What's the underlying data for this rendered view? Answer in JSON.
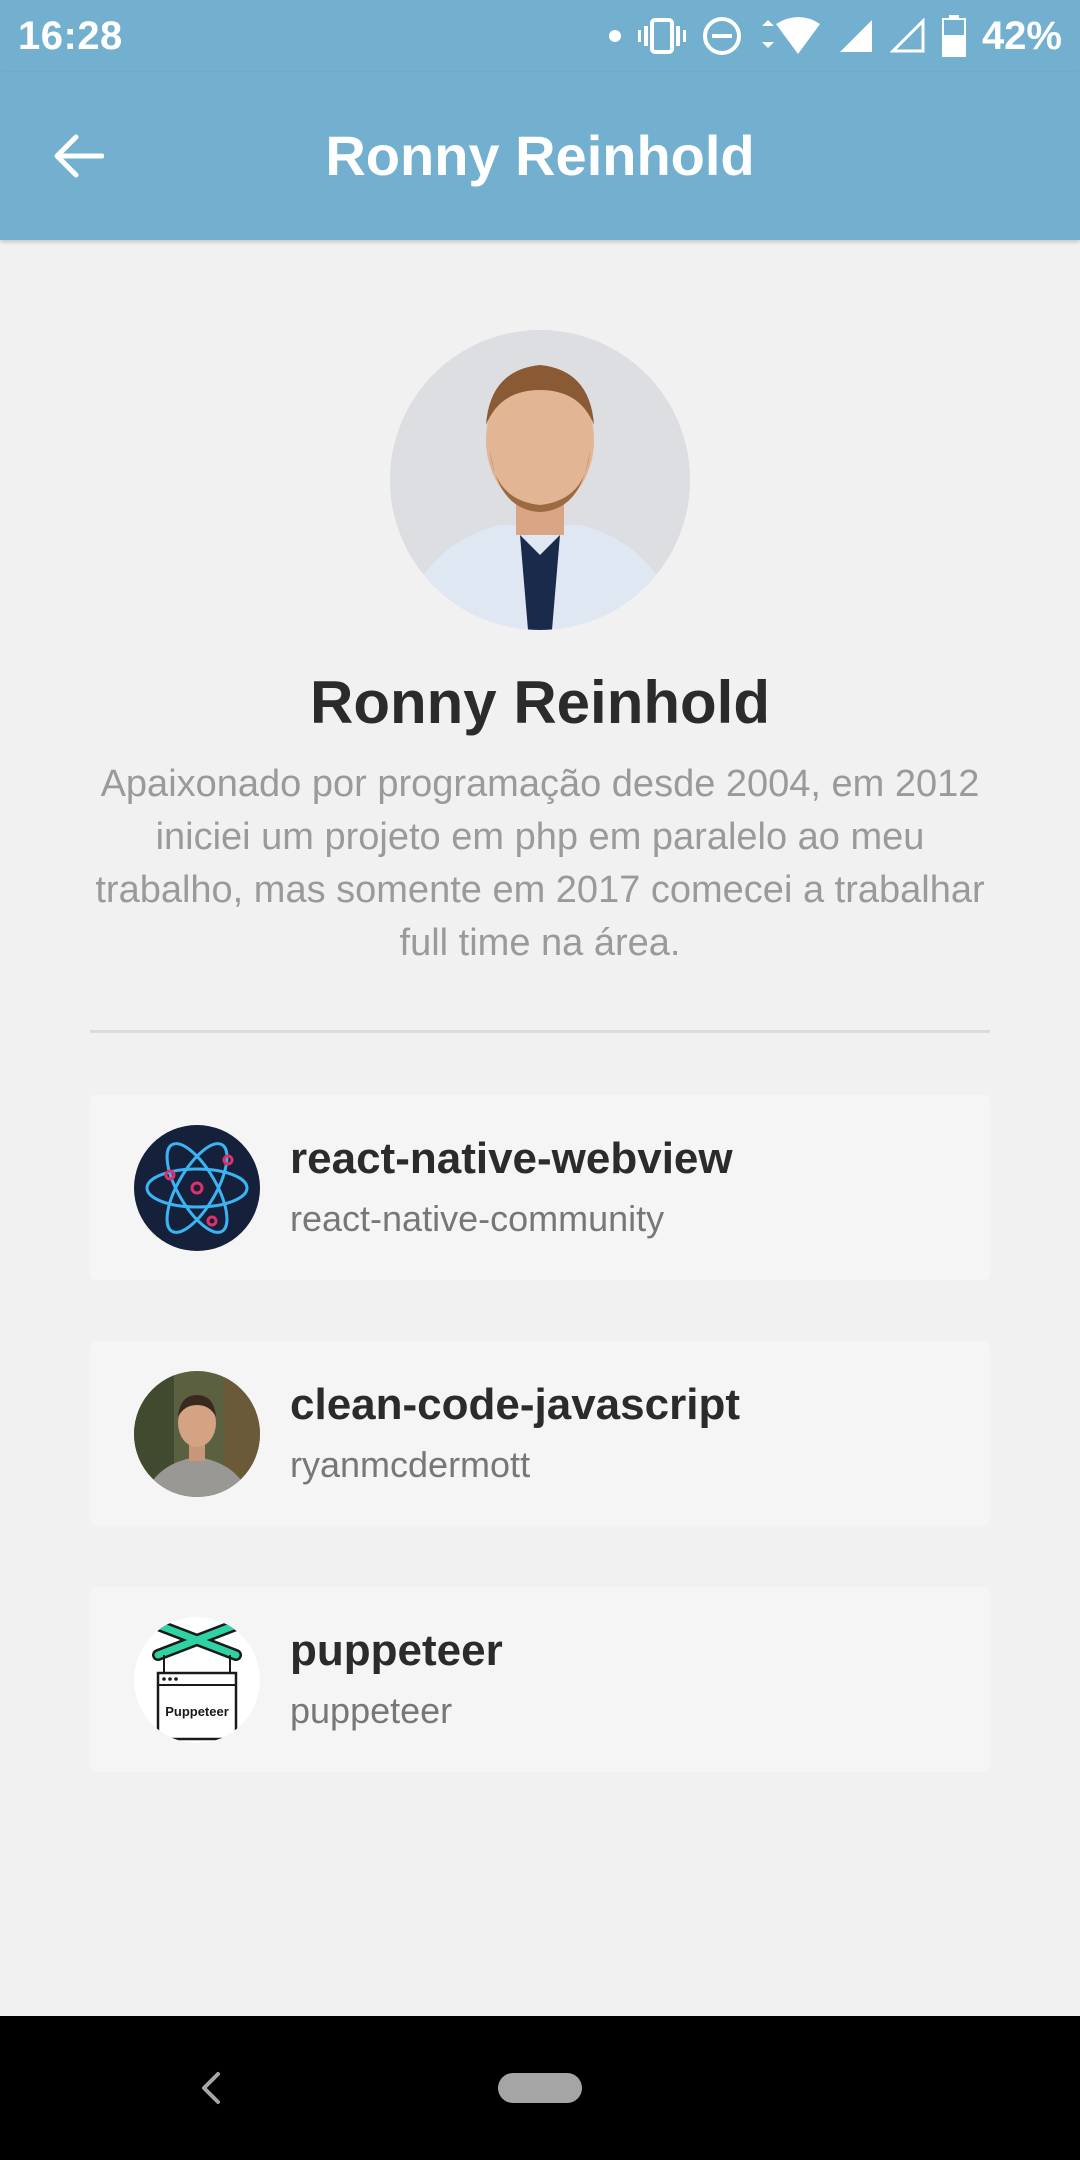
{
  "status_bar": {
    "time": "16:28",
    "battery_percent": "42%",
    "icons": [
      "notification-dot-icon",
      "vibrate-icon",
      "do-not-disturb-icon",
      "wifi-icon",
      "signal-icon",
      "signal-empty-icon",
      "battery-icon"
    ]
  },
  "app_bar": {
    "title": "Ronny Reinhold",
    "back_icon": "arrow-left-icon",
    "background": "#73b0cf"
  },
  "profile": {
    "name": "Ronny Reinhold",
    "bio": "Apaixonado por programação desde 2004, em 2012 iniciei um projeto em php em paralelo ao meu trabalho, mas somente em 2017 comecei a trabalhar full time na área."
  },
  "repositories": [
    {
      "name": "react-native-webview",
      "owner": "react-native-community",
      "avatar": "react-atom-logo"
    },
    {
      "name": "clean-code-javascript",
      "owner": "ryanmcdermott",
      "avatar": "user-photo"
    },
    {
      "name": "puppeteer",
      "owner": "puppeteer",
      "avatar": "puppeteer-logo",
      "logo_text": "Puppeteer"
    }
  ],
  "nav_bar": {
    "icons": [
      "nav-back-icon",
      "nav-home-pill"
    ]
  }
}
